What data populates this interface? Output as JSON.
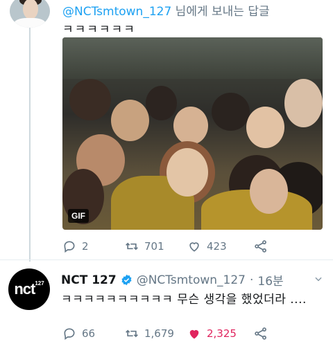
{
  "reply_tweet": {
    "mention": "@NCTsmtown_127",
    "reply_suffix": " 님에게 보내는 답글",
    "text": "ㅋㅋㅋㅋㅋㅋ",
    "media_badge": "GIF",
    "actions": {
      "replies": "2",
      "retweets": "701",
      "likes": "423"
    }
  },
  "main_tweet": {
    "name": "NCT 127",
    "handle": "@NCTsmtown_127",
    "time_sep": "·",
    "time": "16분",
    "text": "ㅋㅋㅋㅋㅋㅋㅋㅋㅋㅋ 무슨 생각을 했었더라 ....",
    "avatar_text": "nct",
    "avatar_num": "127",
    "actions": {
      "replies": "66",
      "retweets": "1,679",
      "likes": "2,325"
    }
  },
  "colors": {
    "link": "#1da1f2",
    "muted": "#657786",
    "like_active": "#e0245e",
    "verified": "#1da1f2"
  },
  "icons": [
    "reply-icon",
    "retweet-icon",
    "like-icon",
    "share-icon",
    "verified-badge-icon",
    "chevron-down-icon"
  ]
}
